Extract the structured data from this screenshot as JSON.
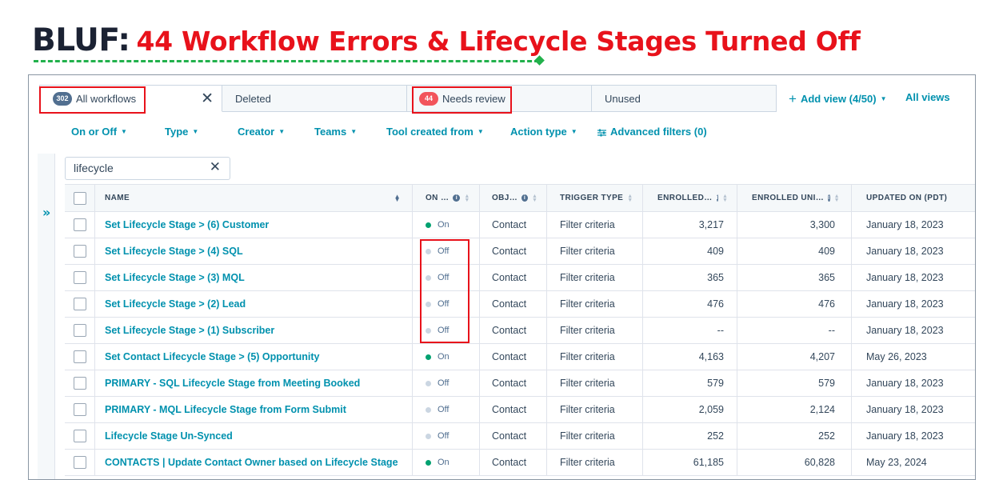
{
  "headline": {
    "lead": "BLUF:",
    "rest": "44 Workflow Errors & Lifecycle Stages Turned Off"
  },
  "tabs": [
    {
      "count": "302",
      "label": "All workflows",
      "active": true
    },
    {
      "label": "Deleted"
    },
    {
      "count": "44",
      "label": "Needs review"
    },
    {
      "label": "Unused"
    }
  ],
  "add_view": "Add view (4/50)",
  "all_views": "All views",
  "filters": [
    "On or Off",
    "Type",
    "Creator",
    "Teams",
    "Tool created from",
    "Action type"
  ],
  "advanced_filters": "Advanced filters (0)",
  "search": {
    "value": "lifecycle"
  },
  "columns": [
    "NAME",
    "ON …",
    "OBJ…",
    "TRIGGER TYPE",
    "ENROLLED…",
    "ENROLLED UNI…",
    "UPDATED ON (PDT)"
  ],
  "rows": [
    {
      "name": "Set Lifecycle Stage > (6) Customer",
      "status": "On",
      "object": "Contact",
      "trigger": "Filter criteria",
      "enrolled": "3,217",
      "unique": "3,300",
      "updated": "January 18, 2023"
    },
    {
      "name": "Set Lifecycle Stage > (4) SQL",
      "status": "Off",
      "object": "Contact",
      "trigger": "Filter criteria",
      "enrolled": "409",
      "unique": "409",
      "updated": "January 18, 2023"
    },
    {
      "name": "Set Lifecycle Stage > (3) MQL",
      "status": "Off",
      "object": "Contact",
      "trigger": "Filter criteria",
      "enrolled": "365",
      "unique": "365",
      "updated": "January 18, 2023"
    },
    {
      "name": "Set Lifecycle Stage > (2) Lead",
      "status": "Off",
      "object": "Contact",
      "trigger": "Filter criteria",
      "enrolled": "476",
      "unique": "476",
      "updated": "January 18, 2023"
    },
    {
      "name": "Set Lifecycle Stage > (1) Subscriber",
      "status": "Off",
      "object": "Contact",
      "trigger": "Filter criteria",
      "enrolled": "--",
      "unique": "--",
      "updated": "January 18, 2023"
    },
    {
      "name": "Set Contact Lifecycle Stage > (5) Opportunity",
      "status": "On",
      "object": "Contact",
      "trigger": "Filter criteria",
      "enrolled": "4,163",
      "unique": "4,207",
      "updated": "May 26, 2023"
    },
    {
      "name": "PRIMARY - SQL Lifecycle Stage from Meeting Booked",
      "status": "Off",
      "object": "Contact",
      "trigger": "Filter criteria",
      "enrolled": "579",
      "unique": "579",
      "updated": "January 18, 2023"
    },
    {
      "name": "PRIMARY - MQL Lifecycle Stage from Form Submit",
      "status": "Off",
      "object": "Contact",
      "trigger": "Filter criteria",
      "enrolled": "2,059",
      "unique": "2,124",
      "updated": "January 18, 2023"
    },
    {
      "name": "Lifecycle Stage Un-Synced",
      "status": "Off",
      "object": "Contact",
      "trigger": "Filter criteria",
      "enrolled": "252",
      "unique": "252",
      "updated": "January 18, 2023"
    },
    {
      "name": "CONTACTS | Update Contact Owner based on Lifecycle Stage",
      "status": "On",
      "object": "Contact",
      "trigger": "Filter criteria",
      "enrolled": "61,185",
      "unique": "60,828",
      "updated": "May 23, 2024"
    }
  ],
  "colors": {
    "accent": "#0091ae",
    "highlight": "#e8121b",
    "on": "#00a170",
    "off": "#cbd6e2",
    "headline_dark": "#1b2233",
    "underline": "#22b14c"
  }
}
